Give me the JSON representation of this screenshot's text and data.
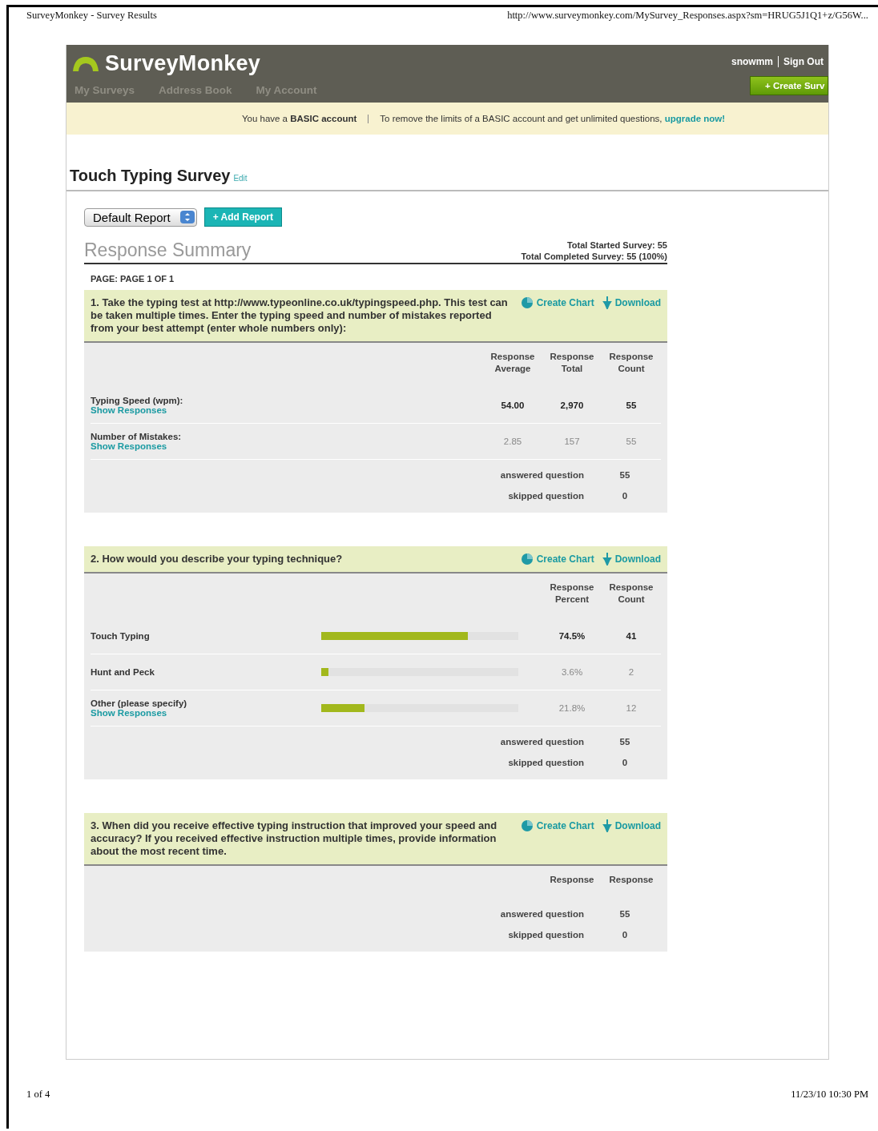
{
  "print_header": {
    "title": "SurveyMonkey - Survey Results",
    "url": "http://www.surveymonkey.com/MySurvey_Responses.aspx?sm=HRUG5J1Q1+z/G56W..."
  },
  "site": {
    "logo": "SurveyMonkey",
    "user": "snowmm",
    "sign_out": "Sign Out",
    "create_button": "+ Create Surv",
    "nav": [
      {
        "label": "My Surveys",
        "selected": false
      },
      {
        "label": "Address Book",
        "selected": false
      },
      {
        "label": "My Account",
        "selected": false
      }
    ],
    "notice": {
      "account": "You have a **BASIC account**",
      "message": "To remove the limits of a BASIC account and get unlimited questions,",
      "link": "upgrade now!"
    }
  },
  "survey": {
    "title": "Touch Typing Survey",
    "edit": "Edit",
    "report_select": "Default Report",
    "add_report": "+ Add Report",
    "summary_title": "Response Summary",
    "total_started": "Total Started Survey: 55",
    "total_completed": "Total Completed Survey: 55  (100%)",
    "page_label": "PAGE: PAGE 1 OF 1"
  },
  "questions": [
    {
      "kind": "matrix",
      "text": "1. Take the typing test at http://www.typeonline.co.uk/typingspeed.php. This test can be taken multiple times. Enter the typing speed and number of mistakes reported from your best attempt (enter whole numbers only):",
      "create_chart": "Create Chart",
      "download": "Download",
      "columns": [
        "Response Average",
        "Response Total",
        "Response Count"
      ],
      "rows": [
        {
          "label": "Typing Speed (wpm):",
          "link": "Show Responses",
          "highlighted": true,
          "cells": [
            "54.00",
            "2,970",
            "55"
          ]
        },
        {
          "label": "Number of Mistakes:",
          "link": "Show Responses",
          "highlighted": false,
          "cells": [
            "2.85",
            "157",
            "55"
          ]
        }
      ],
      "answered_label": "answered question",
      "answered": "55",
      "skipped_label": "skipped question",
      "skipped": "0"
    },
    {
      "kind": "choice",
      "text": "2. How would you describe your typing technique?",
      "create_chart": "Create Chart",
      "download": "Download",
      "columns": [
        "Response Percent",
        "Response Count"
      ],
      "rows": [
        {
          "label": "Touch Typing",
          "highlighted": true,
          "level": 0.745,
          "cells": [
            "74.5%",
            "41"
          ]
        },
        {
          "label": "Hunt and Peck",
          "highlighted": false,
          "level": 0.036,
          "cells": [
            "3.6%",
            "2"
          ]
        },
        {
          "label": "Other (please specify)",
          "link": "Show Responses",
          "highlighted": false,
          "level": 0.218,
          "cells": [
            "21.8%",
            "12"
          ]
        }
      ],
      "answered_label": "answered question",
      "answered": "55",
      "skipped_label": "skipped question",
      "skipped": "0"
    },
    {
      "kind": "text",
      "text": "3. When did you receive effective typing instruction that improved your speed and accuracy? If you received effective instruction multiple times, provide information about the most recent time.",
      "create_chart": "Create Chart",
      "download": "Download",
      "columns": [
        "Response",
        "Response"
      ],
      "answered_label": "answered question",
      "answered": "55",
      "skipped_label": "skipped question",
      "skipped": "0"
    }
  ],
  "print_footer": {
    "page": "1 of 4",
    "date": "11/23/10 10:30 PM"
  }
}
